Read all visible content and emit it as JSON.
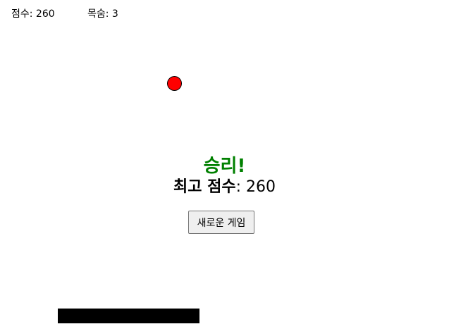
{
  "hud": {
    "score_label": "점수: 260",
    "lives_label": "목숨: 3"
  },
  "message": {
    "title": "승리!",
    "best_score_label": "최고 점수",
    "best_score_value": ": 260"
  },
  "button": {
    "new_game_label": "새로운 게임"
  },
  "colors": {
    "ball": "#ff0000",
    "title": "#008000",
    "paddle": "#000000",
    "background": "#ffffff"
  }
}
